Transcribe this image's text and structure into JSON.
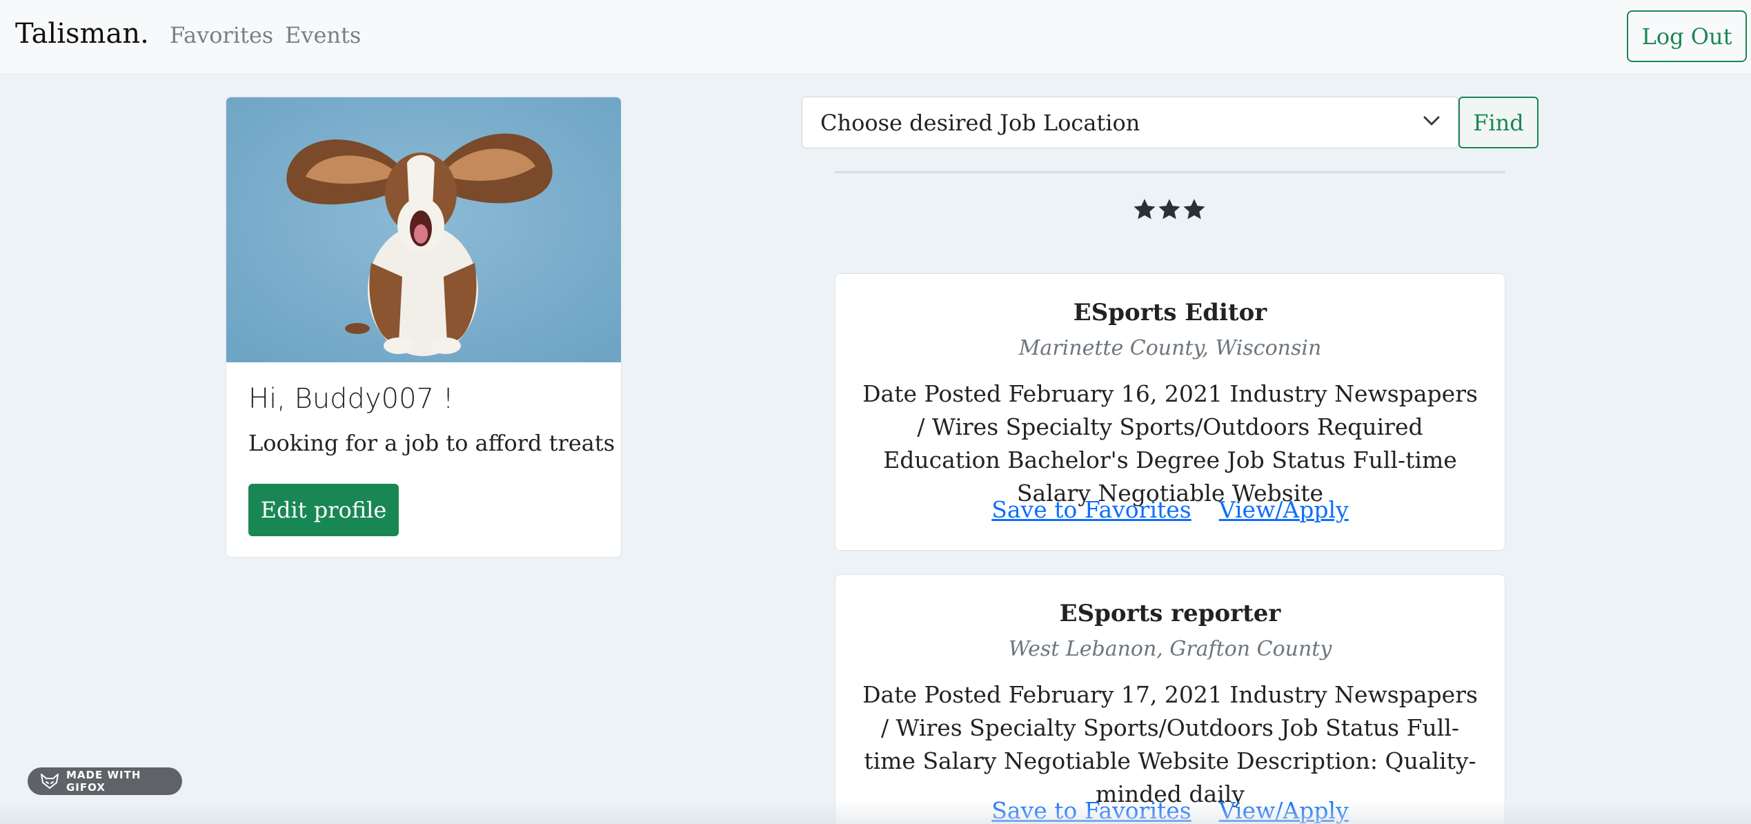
{
  "nav": {
    "brand": "Talisman.",
    "links": [
      "Favorites",
      "Events"
    ],
    "logout_label": "Log Out"
  },
  "profile": {
    "greeting": "Hi, Buddy007 !",
    "bio": "Looking for a job to afford treats",
    "edit_label": "Edit profile"
  },
  "search": {
    "select_value": "Choose desired Job Location",
    "find_label": "Find"
  },
  "rating": {
    "stars": 3
  },
  "jobs": [
    {
      "title": "ESports Editor",
      "location": "Marinette County, Wisconsin",
      "description": "Date Posted February 16, 2021 Industry Newspapers / Wires Specialty Sports/Outdoors Required Education Bachelor's Degree Job Status Full-time Salary Negotiable Website",
      "save_label": "Save to Favorites",
      "apply_label": "View/Apply"
    },
    {
      "title": "ESports reporter",
      "location": "West Lebanon, Grafton County",
      "description": "Date Posted February 17, 2021 Industry Newspapers / Wires Specialty Sports/Outdoors Job Status Full-time Salary Negotiable Website Description: Quality-minded daily",
      "save_label": "Save to Favorites",
      "apply_label": "View/Apply"
    }
  ],
  "badge": {
    "label": "MADE WITH GIFOX"
  },
  "colors": {
    "accent": "#198754",
    "link": "#0d6efd",
    "background": "#edf2f7",
    "navbar": "#f8f9fa"
  }
}
